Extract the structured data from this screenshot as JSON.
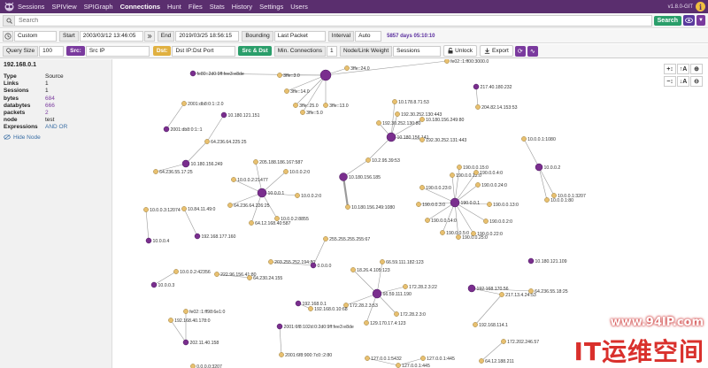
{
  "nav": {
    "items": [
      "Sessions",
      "SPIView",
      "SPIGraph",
      "Connections",
      "Hunt",
      "Files",
      "Stats",
      "History",
      "Settings",
      "Users"
    ],
    "active": "Connections",
    "version": "v1.8.0-GIT"
  },
  "search": {
    "placeholder": "Search",
    "button": "Search"
  },
  "time": {
    "range": "Custom",
    "start_label": "Start",
    "start": "2003/03/12 13:46:05",
    "end_label": "End",
    "end": "2019/03/25 18:56:15",
    "bounding_label": "Bounding",
    "bounding": "Last Packet",
    "interval_label": "Interval",
    "interval": "Auto",
    "days_info": "5857 days 05:10:10"
  },
  "tools": {
    "query_size_label": "Query Size",
    "query_size": "100",
    "src_tag": "Src:",
    "src_value": "Src IP",
    "dst_tag": "Dst:",
    "dst_value": "Dst IP:Dst Port",
    "src_dst": "Src & Dst",
    "min_conn_label": "Min. Connections",
    "min_conn": "1",
    "weight_label": "Node/Link Weight",
    "weight": "Sessions",
    "unlock": "Unlock",
    "export": "Export"
  },
  "node_panel": {
    "title": "192.168.0.1",
    "fields": [
      {
        "k": "Type",
        "v": "Source",
        "style": ""
      },
      {
        "k": "Links",
        "v": "1",
        "style": ""
      },
      {
        "k": "Sessions",
        "v": "1",
        "style": ""
      },
      {
        "k": "bytes",
        "v": "684",
        "style": "link"
      },
      {
        "k": "databytes",
        "v": "666",
        "style": "link"
      },
      {
        "k": "packets",
        "v": "2",
        "style": "link"
      },
      {
        "k": "node",
        "v": "test",
        "style": ""
      },
      {
        "k": "Expressions",
        "v": "AND  OR",
        "style": "blue"
      }
    ],
    "hide": "Hide Node"
  },
  "colors": {
    "purple": "#7a2e8e",
    "gold": "#e8c070",
    "link": "#9a9a9a"
  },
  "graph": {
    "nodes": [
      {
        "id": "fe80",
        "t": "s",
        "label": "fe80::2d0:9ff:fee3:e8de"
      },
      {
        "id": "ffc1",
        "t": "s",
        "label": ""
      },
      {
        "id": "ffc24",
        "t": "d",
        "label": "3ffe::24.0"
      },
      {
        "id": "ffc30",
        "t": "d",
        "label": "3ffe::3.0"
      },
      {
        "id": "ffc140",
        "t": "d",
        "label": "3ffe::14.0"
      },
      {
        "id": "ffc250",
        "t": "d",
        "label": "3ffe::25.0"
      },
      {
        "id": "ffc130",
        "t": "d",
        "label": "3ffe::13.0"
      },
      {
        "id": "ffc50",
        "t": "d",
        "label": "3ffe::5.0"
      },
      {
        "id": "fe02",
        "t": "d",
        "label": "fe02::1:ff00:3000.0"
      },
      {
        "id": "s2001a",
        "t": "d",
        "label": "2001:db8:0:1::2.0"
      },
      {
        "id": "s2001b",
        "t": "s",
        "label": "2001:db8:0:1::1"
      },
      {
        "id": "n101",
        "t": "s",
        "label": "10.180.121.151"
      },
      {
        "id": "n64",
        "t": "d",
        "label": "64.236.64.225:25"
      },
      {
        "id": "n249",
        "t": "s",
        "label": "10.180.156.249"
      },
      {
        "id": "n6455",
        "t": "d",
        "label": "64.236.55.17:25"
      },
      {
        "id": "n217",
        "t": "s",
        "label": "217.40.180.232"
      },
      {
        "id": "n204",
        "t": "d",
        "label": "204.82.14.153:53"
      },
      {
        "id": "n178",
        "t": "d",
        "label": "10.178.8.71:53"
      },
      {
        "id": "n192_130",
        "t": "d",
        "label": "192.30.252.130:443"
      },
      {
        "id": "n192_130b",
        "t": "d",
        "label": "192.30.252.130:80"
      },
      {
        "id": "n249_80",
        "t": "d",
        "label": "10.180.156.249:80"
      },
      {
        "id": "n141",
        "t": "s",
        "label": "10.180.156.141"
      },
      {
        "id": "n192_131",
        "t": "d",
        "label": "192.30.252.131:443"
      },
      {
        "id": "n10295",
        "t": "d",
        "label": "10.2.95.39:53"
      },
      {
        "id": "n185",
        "t": "s",
        "label": "10.180.156.185"
      },
      {
        "id": "n1080",
        "t": "d",
        "label": "10.180.156.249:1080"
      },
      {
        "id": "n200",
        "t": "d",
        "label": "205.188.186.167:587"
      },
      {
        "id": "n10002",
        "t": "d",
        "label": "10.0.0.2:21477"
      },
      {
        "id": "n10001",
        "t": "s",
        "label": "10.0.0.1"
      },
      {
        "id": "n10002b",
        "t": "d",
        "label": "10.0.0.2:0"
      },
      {
        "id": "n10002c",
        "t": "d",
        "label": "10.0.0.2:0"
      },
      {
        "id": "n64_236",
        "t": "d",
        "label": "64.236.64.226:25"
      },
      {
        "id": "n64_12",
        "t": "d",
        "label": "64.12.168.40:587"
      },
      {
        "id": "n10008855",
        "t": "d",
        "label": "10.0.0.2:8855"
      },
      {
        "id": "n1000312074",
        "t": "d",
        "label": "10.0.0.3:12074"
      },
      {
        "id": "n108411",
        "t": "d",
        "label": "10.84.11.49:0"
      },
      {
        "id": "n10004",
        "t": "s",
        "label": "10.0.0.4"
      },
      {
        "id": "n192177",
        "t": "s",
        "label": "192.168.177.160"
      },
      {
        "id": "n1001080",
        "t": "d",
        "label": "10.0.0.1:1080"
      },
      {
        "id": "n10002s",
        "t": "s",
        "label": "10.0.0.2"
      },
      {
        "id": "n1003207",
        "t": "d",
        "label": "10.0.0.1:3207"
      },
      {
        "id": "n10001b",
        "t": "d",
        "label": "10.0.0.1:80"
      },
      {
        "id": "n190150",
        "t": "d",
        "label": "190.0.0.15:0"
      },
      {
        "id": "n190120",
        "t": "d",
        "label": "190.0.0.12:0"
      },
      {
        "id": "n19040",
        "t": "d",
        "label": "190.0.0.4:0"
      },
      {
        "id": "n190230",
        "t": "d",
        "label": "190.0.0.23:0"
      },
      {
        "id": "n190240",
        "t": "d",
        "label": "190.0.0.24:0"
      },
      {
        "id": "n19030",
        "t": "d",
        "label": "190.0.0.3:0"
      },
      {
        "id": "n19001",
        "t": "s",
        "label": "190.0.0.1"
      },
      {
        "id": "n190130",
        "t": "d",
        "label": "190.0.0.13:0"
      },
      {
        "id": "n190140",
        "t": "d",
        "label": "190.0.0.14:0"
      },
      {
        "id": "n19050",
        "t": "d",
        "label": "190.0.0.5:0"
      },
      {
        "id": "n19020",
        "t": "d",
        "label": "190.0.0.2:0"
      },
      {
        "id": "n190220",
        "t": "d",
        "label": "190.0.0.22:0"
      },
      {
        "id": "n190250",
        "t": "d",
        "label": "190.0.0.25:0"
      },
      {
        "id": "n255",
        "t": "d",
        "label": "255.255.255.255:67"
      },
      {
        "id": "n203",
        "t": "d",
        "label": "203.255.252.194:80"
      },
      {
        "id": "n0000",
        "t": "s",
        "label": "0.0.0.0"
      },
      {
        "id": "n1000242356",
        "t": "d",
        "label": "10.0.0.2:42356"
      },
      {
        "id": "n10003",
        "t": "s",
        "label": "10.0.0.3"
      },
      {
        "id": "n222",
        "t": "d",
        "label": "222.96.156.41:80"
      },
      {
        "id": "n64_230",
        "t": "d",
        "label": "64.230.24.155"
      },
      {
        "id": "n18",
        "t": "d",
        "label": "18.26.4.105:123"
      },
      {
        "id": "n66",
        "t": "d",
        "label": "66.59.111.182:123"
      },
      {
        "id": "n66s",
        "t": "s",
        "label": "66.59.111.190"
      },
      {
        "id": "n172283",
        "t": "d",
        "label": "172.28.2.3:22"
      },
      {
        "id": "n172",
        "t": "d",
        "label": "172.28.2.3:53"
      },
      {
        "id": "n172283b",
        "t": "d",
        "label": "172.28.2.3:0"
      },
      {
        "id": "n129",
        "t": "d",
        "label": "129.170.17.4:123"
      },
      {
        "id": "n19201",
        "t": "s",
        "label": "192.168.0.1"
      },
      {
        "id": "n192010",
        "t": "d",
        "label": "192.168.0.10:68"
      },
      {
        "id": "n1921109",
        "t": "s",
        "label": "10.180.121.109"
      },
      {
        "id": "n19217056",
        "t": "s",
        "label": "192.168.170.56"
      },
      {
        "id": "n217134",
        "t": "d",
        "label": "217.13.4.24:53"
      },
      {
        "id": "n64_55",
        "t": "d",
        "label": "64.236.55.18:25"
      },
      {
        "id": "fe02b",
        "t": "d",
        "label": "fe02::1:ff98:6e1:0"
      },
      {
        "id": "n192_40",
        "t": "d",
        "label": "192.168.40.178:0"
      },
      {
        "id": "n20211",
        "t": "s",
        "label": "202.11.40.158"
      },
      {
        "id": "s2001c",
        "t": "s",
        "label": "2001:6f8:102d:0:2d0:9ff:fee3:e8de"
      },
      {
        "id": "s2001d",
        "t": "d",
        "label": "2001:6f8:900:7c0::2:80"
      },
      {
        "id": "n192114",
        "t": "d",
        "label": "192.168.114.1"
      },
      {
        "id": "n172_202",
        "t": "d",
        "label": "172.202.246.57"
      },
      {
        "id": "n64_12b",
        "t": "d",
        "label": "64.12.188.211"
      },
      {
        "id": "n127",
        "t": "d",
        "label": "127.0.0.1:5432"
      },
      {
        "id": "n1270",
        "t": "d",
        "label": "127.0.0.1:445"
      },
      {
        "id": "n0003207",
        "t": "d",
        "label": "0.0.0.0:3207"
      },
      {
        "id": "n127s",
        "t": "d",
        "label": "127.0.0.1:445"
      }
    ]
  }
}
